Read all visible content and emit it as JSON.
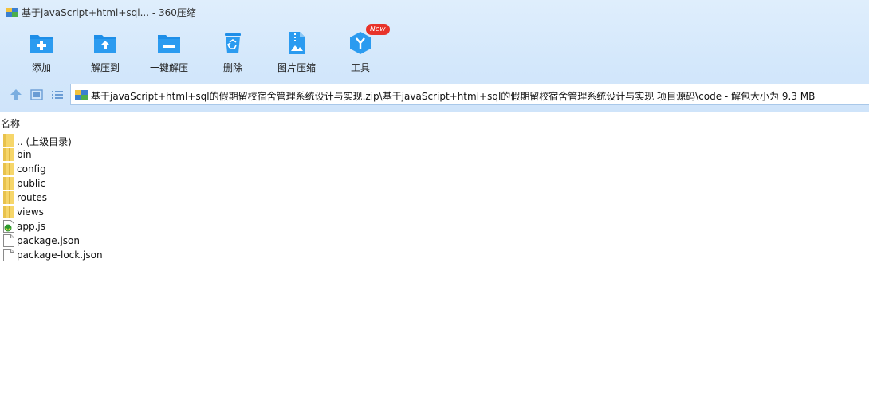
{
  "window": {
    "title": "基于javaScript+html+sql... - 360压缩"
  },
  "toolbar": {
    "items": [
      {
        "label": "添加",
        "icon": "add-folder-icon"
      },
      {
        "label": "解压到",
        "icon": "extract-to-icon"
      },
      {
        "label": "一键解压",
        "icon": "one-click-extract-icon"
      },
      {
        "label": "删除",
        "icon": "recycle-bin-icon"
      },
      {
        "label": "图片压缩",
        "icon": "image-compress-icon"
      },
      {
        "label": "工具",
        "icon": "tools-cube-icon",
        "badge": "New"
      }
    ]
  },
  "nav": {
    "path": "基于javaScript+html+sql的假期留校宿舍管理系统设计与实现.zip\\基于javaScript+html+sql的假期留校宿舍管理系统设计与实现 项目源码\\code - 解包大小为 9.3 MB"
  },
  "list": {
    "column_name": "名称",
    "items": [
      {
        "name": ".. (上级目录)",
        "type": "folder"
      },
      {
        "name": "bin",
        "type": "folder"
      },
      {
        "name": "config",
        "type": "folder"
      },
      {
        "name": "public",
        "type": "folder"
      },
      {
        "name": "routes",
        "type": "folder"
      },
      {
        "name": "views",
        "type": "folder"
      },
      {
        "name": "app.js",
        "type": "js"
      },
      {
        "name": "package.json",
        "type": "file"
      },
      {
        "name": "package-lock.json",
        "type": "file"
      }
    ]
  },
  "colors": {
    "accent": "#1e8ee8",
    "folder": "#f6d66a",
    "badge": "#e8332a"
  }
}
